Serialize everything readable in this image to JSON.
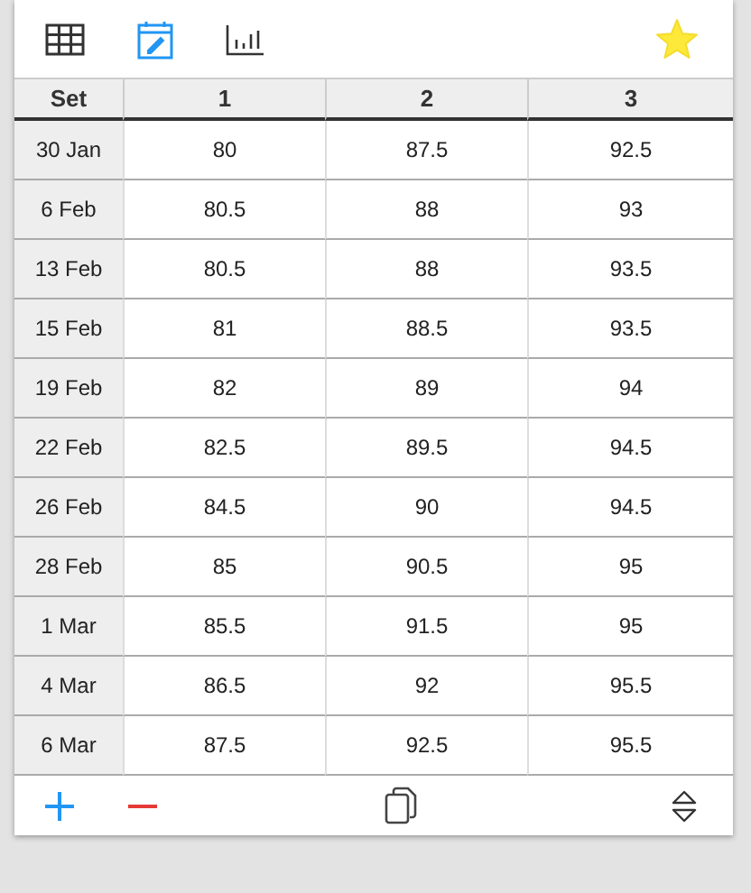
{
  "toolbar": {
    "views": [
      {
        "kind": "table",
        "selected": false
      },
      {
        "kind": "calendar",
        "selected": true
      },
      {
        "kind": "chart",
        "selected": false
      }
    ],
    "favorite": true
  },
  "table": {
    "columns": [
      "Set",
      "1",
      "2",
      "3"
    ],
    "rows": [
      [
        "30 Jan",
        "80",
        "87.5",
        "92.5"
      ],
      [
        "6 Feb",
        "80.5",
        "88",
        "93"
      ],
      [
        "13 Feb",
        "80.5",
        "88",
        "93.5"
      ],
      [
        "15 Feb",
        "81",
        "88.5",
        "93.5"
      ],
      [
        "19 Feb",
        "82",
        "89",
        "94"
      ],
      [
        "22 Feb",
        "82.5",
        "89.5",
        "94.5"
      ],
      [
        "26 Feb",
        "84.5",
        "90",
        "94.5"
      ],
      [
        "28 Feb",
        "85",
        "90.5",
        "95"
      ],
      [
        "1 Mar",
        "85.5",
        "91.5",
        "95"
      ],
      [
        "4 Mar",
        "86.5",
        "92",
        "95.5"
      ],
      [
        "6 Mar",
        "87.5",
        "92.5",
        "95.5"
      ]
    ]
  }
}
